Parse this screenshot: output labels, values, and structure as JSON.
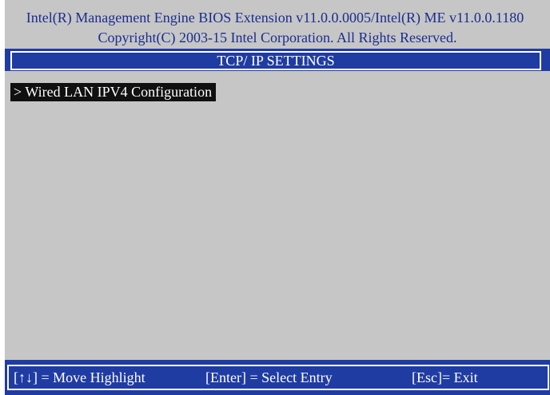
{
  "header": {
    "line1": "Intel(R) Management Engine BIOS Extension v11.0.0.0005/Intel(R) ME v11.0.0.1180",
    "line2": "Copyright(C) 2003-15 Intel Corporation. All Rights Reserved."
  },
  "screen": {
    "title": "TCP/ IP SETTINGS"
  },
  "menu": {
    "items": [
      {
        "label": "> Wired LAN IPV4 Configuration",
        "selected": true
      }
    ]
  },
  "footer": {
    "hints": [
      {
        "text": "[↑↓] = Move Highlight"
      },
      {
        "text": "[Enter] = Select Entry"
      },
      {
        "text": "[Esc]= Exit"
      }
    ]
  },
  "colors": {
    "background": "#c6c6c6",
    "header_text": "#1a2d8f",
    "bar": "#1f3ca3",
    "highlight": "#101010",
    "text_light": "#ffffff"
  }
}
